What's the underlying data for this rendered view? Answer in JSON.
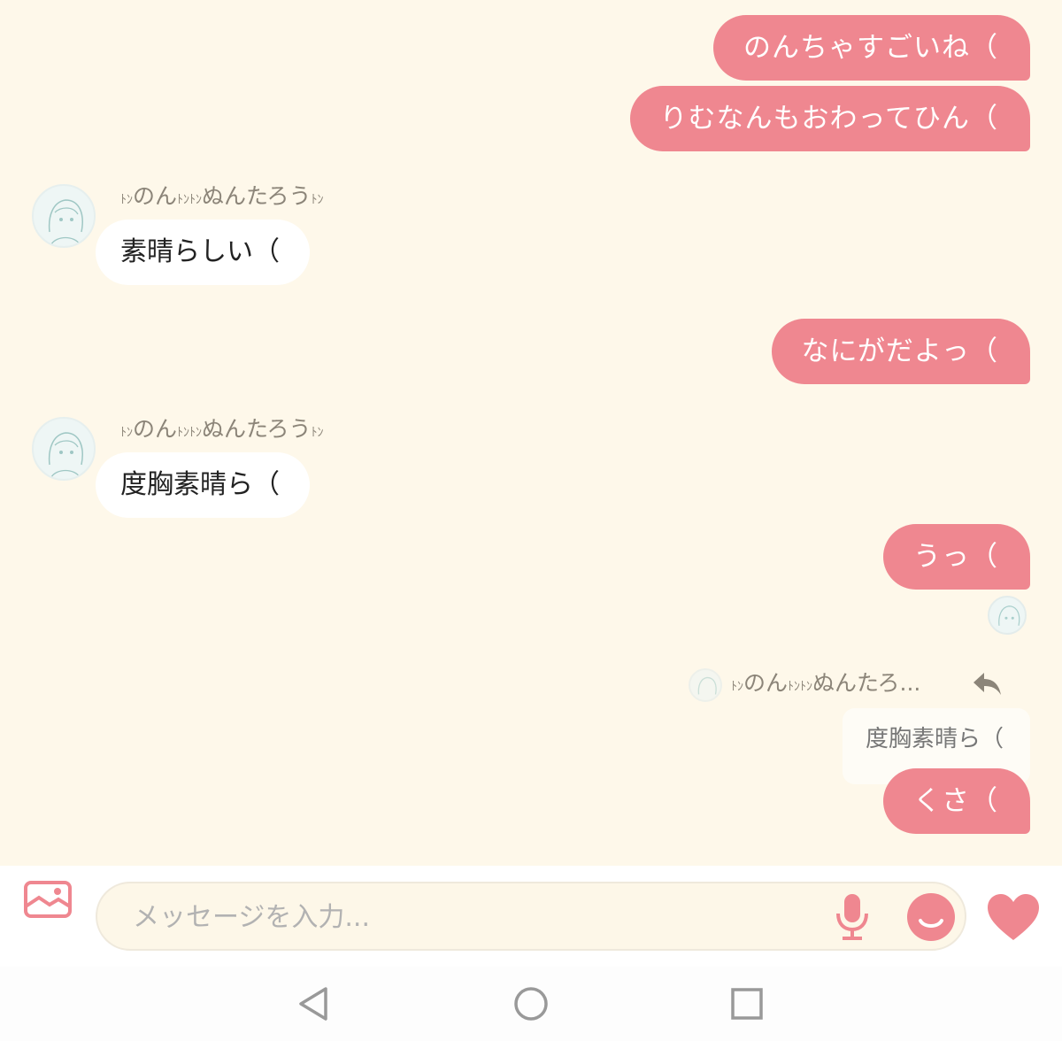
{
  "colors": {
    "accent": "#ef8790",
    "chat_background": "#fef8ea",
    "incoming_bubble": "#ffffff",
    "sender_text": "#8c8579"
  },
  "messages": {
    "m1": "のんちゃすごいね（",
    "m2": "りむなんもおわってひん（",
    "m3_sender_a": "ﾄﾝ",
    "m3_sender_b": "のん",
    "m3_sender_c": "ﾄﾝﾄﾝ",
    "m3_sender_d": "ぬんたろう",
    "m3_sender_e": "ﾄﾝ",
    "m3": "素晴らしい（",
    "m4": "なにがだよっ（",
    "m5_sender_a": "ﾄﾝ",
    "m5_sender_b": "のん",
    "m5_sender_c": "ﾄﾝﾄﾝ",
    "m5_sender_d": "ぬんたろう",
    "m5_sender_e": "ﾄﾝ",
    "m5": "度胸素晴ら（",
    "m6": "うっ（",
    "reply_name_a": "ﾄﾝ",
    "reply_name_b": "のん",
    "reply_name_c": "ﾄﾝﾄﾝ",
    "reply_name_d": "ぬんたろ...",
    "reply_quote": "度胸素晴ら（",
    "m7": "くさ（"
  },
  "composer": {
    "placeholder": "メッセージを入力...",
    "icons": [
      "image-icon",
      "microphone-icon",
      "emoji-icon",
      "heart-icon"
    ]
  },
  "navigation": {
    "icons": [
      "back-icon",
      "home-icon",
      "recents-icon"
    ]
  }
}
